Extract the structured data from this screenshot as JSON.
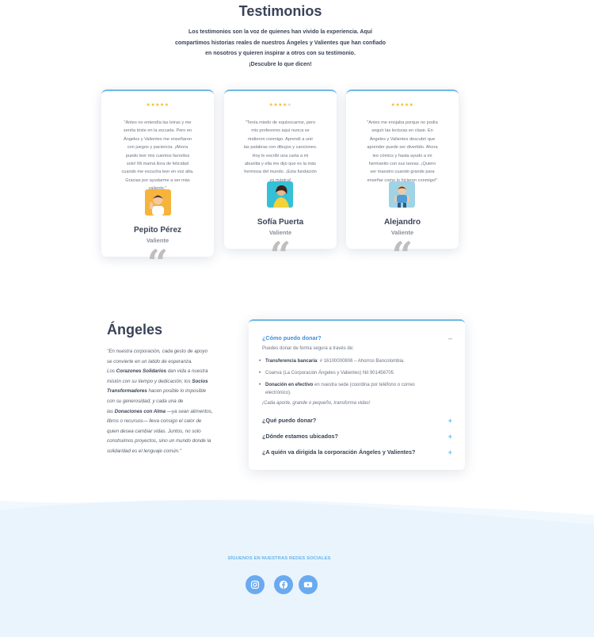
{
  "testimonials": {
    "title": "Testimonios",
    "intro": [
      "Los testimonios son la voz de quienes han vivido la experiencia. Aquí",
      "compartimos historias reales de nuestros Ángeles y Valientes que han confiado",
      "en nosotros y quieren inspirar a otros con su testimonio.",
      "¡Descubre lo que dicen!"
    ],
    "cards": [
      {
        "rating": 5,
        "stars_on": "★★★★★",
        "stars_off": "",
        "quote": [
          "\"Antes no entendía las letras y me",
          "sentía triste en la escuela. Pero en",
          "Ángeles y Valientes me enseñaron",
          "con juegos y paciencia. ¡Ahora",
          "puedo leer mis cuentos favoritos",
          "solo! Mi mamá llora de felicidad",
          "cuando me escucha leer en voz alta.",
          "Gracias por ayudarme a ser más",
          "valiente.\""
        ],
        "name": "Pepito Pérez",
        "role": "Valiente"
      },
      {
        "rating": 4,
        "stars_on": "★★★★",
        "stars_off": "★",
        "quote": [
          "\"Tenía miedo de equivocarme, pero",
          "mis profesores aquí nunca se",
          "rindieron conmigo. Aprendí a unir",
          "las palabras con dibujos y canciones.",
          "Hoy le escribí una carta a mi",
          "abuelita y ella me dijo que es la más",
          "hermosa del mundo. ¡Esta fundación",
          "es mágica!"
        ],
        "name": "Sofía Puerta",
        "role": "Valiente"
      },
      {
        "rating": 5,
        "stars_on": "★★★★★",
        "stars_off": "",
        "quote": [
          "\"Antes me enojaba porque no podía",
          "seguir las lecturas en clase. En",
          "Ángeles y Valientes descubrí que",
          "aprender puede ser divertido. Ahora",
          "leo cómics y hasta ayudo a mi",
          "hermanito con sus tareas. ¡Quiero",
          "ser maestro cuando grande para",
          "enseñar como lo hicieron conmigo!\""
        ],
        "name": "Alejandro",
        "role": "Valiente"
      }
    ],
    "quote_mark": "“"
  },
  "angeles": {
    "title": "Ángeles",
    "lines": [
      [
        {
          "t": "\"En nuestra corporación, cada gesto de apoyo"
        }
      ],
      [
        {
          "t": "se convierte en un latido de esperanza."
        }
      ],
      [
        {
          "t": "Los "
        },
        {
          "t": "Corazones Solidarios",
          "b": true
        },
        {
          "t": " dan vida a nuestra"
        }
      ],
      [
        {
          "t": "misión con su tiempo y dedicación; los "
        },
        {
          "t": "Socios",
          "b": true
        }
      ],
      [
        {
          "t": "Transformadores",
          "b": true
        },
        {
          "t": " hacen posible lo imposible"
        }
      ],
      [
        {
          "t": "con su generosidad; y cada una de"
        }
      ],
      [
        {
          "t": "las "
        },
        {
          "t": "Donaciones con Alma",
          "b": true
        },
        {
          "t": " —ya sean alimentos,"
        }
      ],
      [
        {
          "t": "libros o recursos— lleva consigo el calor de"
        }
      ],
      [
        {
          "t": "quien desea cambiar vidas. Juntos, no solo"
        }
      ],
      [
        {
          "t": "construimos proyectos, sino un mundo donde la"
        }
      ],
      [
        {
          "t": "solidaridad es el lenguaje común.\""
        }
      ]
    ]
  },
  "faq": {
    "q1": "¿Cómo puedo donar?",
    "q1_toggle": "–",
    "q1_intro": "Puedes donar de forma segura a través de:",
    "q1_items": [
      [
        {
          "t": "Transferencia bancaria",
          "b": true
        },
        {
          "t": ": # 16100000806 – Ahorros Bancolombia."
        }
      ],
      [
        {
          "t": "Coanva (La Corporación Ángeles y Valientes) Nit 901456705"
        }
      ],
      [
        {
          "t": "Donación en efectivo",
          "b": true
        },
        {
          "t": " en nuestra sede (coordina por teléfono o correo"
        }
      ],
      [
        {
          "t": "electrónico)."
        }
      ]
    ],
    "q1_footer": "¡Cada aporte, grande o pequeño, transforma vidas!",
    "q2": "¿Qué puedo donar?",
    "q3": "¿Dónde estamos ubicados?",
    "q4": "¿A quién va dirigida la corporación Ángeles y Valientes?",
    "toggle_plus": "+"
  },
  "footer": {
    "follow": "SÍGUENOS EN NUESTRAS REDES SOCIALES",
    "icons": [
      "instagram-icon",
      "facebook-icon",
      "youtube-icon"
    ]
  },
  "colors": {
    "accent_blue": "#6fb8e6",
    "link_blue": "#3f8fd8",
    "footer_bg": "#eaf4fd",
    "star": "#f5b92e",
    "social_button": "#6aaaf0"
  }
}
